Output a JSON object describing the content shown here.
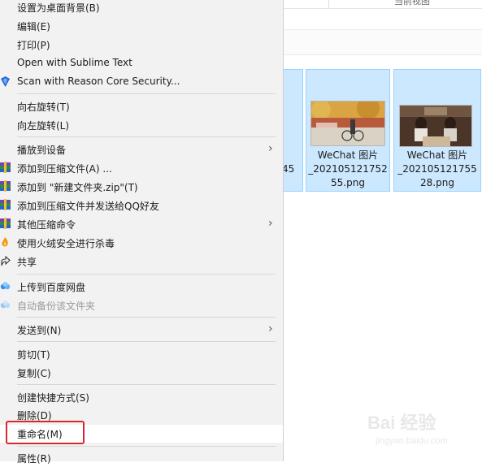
{
  "explorer": {
    "tab_partial_text": "当前视图",
    "files": [
      {
        "caption_lines": [
          "",
          "45"
        ]
      },
      {
        "caption_lines": [
          "WeChat 图片",
          "_202105121752",
          "55.png"
        ]
      },
      {
        "caption_lines": [
          "WeChat 图片",
          "_202105121755",
          "28.png"
        ]
      }
    ]
  },
  "menu": {
    "items": [
      {
        "label": "设置为桌面背景(B)"
      },
      {
        "label": "编辑(E)"
      },
      {
        "label": "打印(P)"
      },
      {
        "label": "Open with Sublime Text"
      },
      {
        "label": "Scan with Reason Core Security...",
        "icon": "shield-icon"
      },
      {
        "label": "向右旋转(T)"
      },
      {
        "label": "向左旋转(L)"
      },
      {
        "label": "播放到设备",
        "submenu": true
      },
      {
        "label": "添加到压缩文件(A) ...",
        "icon": "winrar-icon"
      },
      {
        "label": "添加到 \"新建文件夹.zip\"(T)",
        "icon": "winrar-icon"
      },
      {
        "label": "添加到压缩文件并发送给QQ好友",
        "icon": "winrar-icon"
      },
      {
        "label": "其他压缩命令",
        "icon": "winrar-icon",
        "submenu": true
      },
      {
        "label": "使用火绒安全进行杀毒",
        "icon": "huorong-icon"
      },
      {
        "label": "共享",
        "icon": "share-icon"
      },
      {
        "label": "上传到百度网盘",
        "icon": "baidu-cloud-icon"
      },
      {
        "label": "自动备份该文件夹",
        "icon": "baidu-cloud-icon",
        "disabled": true
      },
      {
        "label": "发送到(N)",
        "submenu": true
      },
      {
        "label": "剪切(T)"
      },
      {
        "label": "复制(C)"
      },
      {
        "label": "创建快捷方式(S)"
      },
      {
        "label": "删除(D)"
      },
      {
        "label": "重命名(M)",
        "highlighted": true
      },
      {
        "label": "属性(R)"
      }
    ]
  },
  "watermark": {
    "brand": "Bai 经验",
    "url": "jingyan.baidu.com"
  },
  "colors": {
    "menu_bg": "#f2f2f2",
    "selection_bg": "#cce8ff",
    "selection_border": "#99d1ff",
    "highlight_box": "#d8282f"
  }
}
